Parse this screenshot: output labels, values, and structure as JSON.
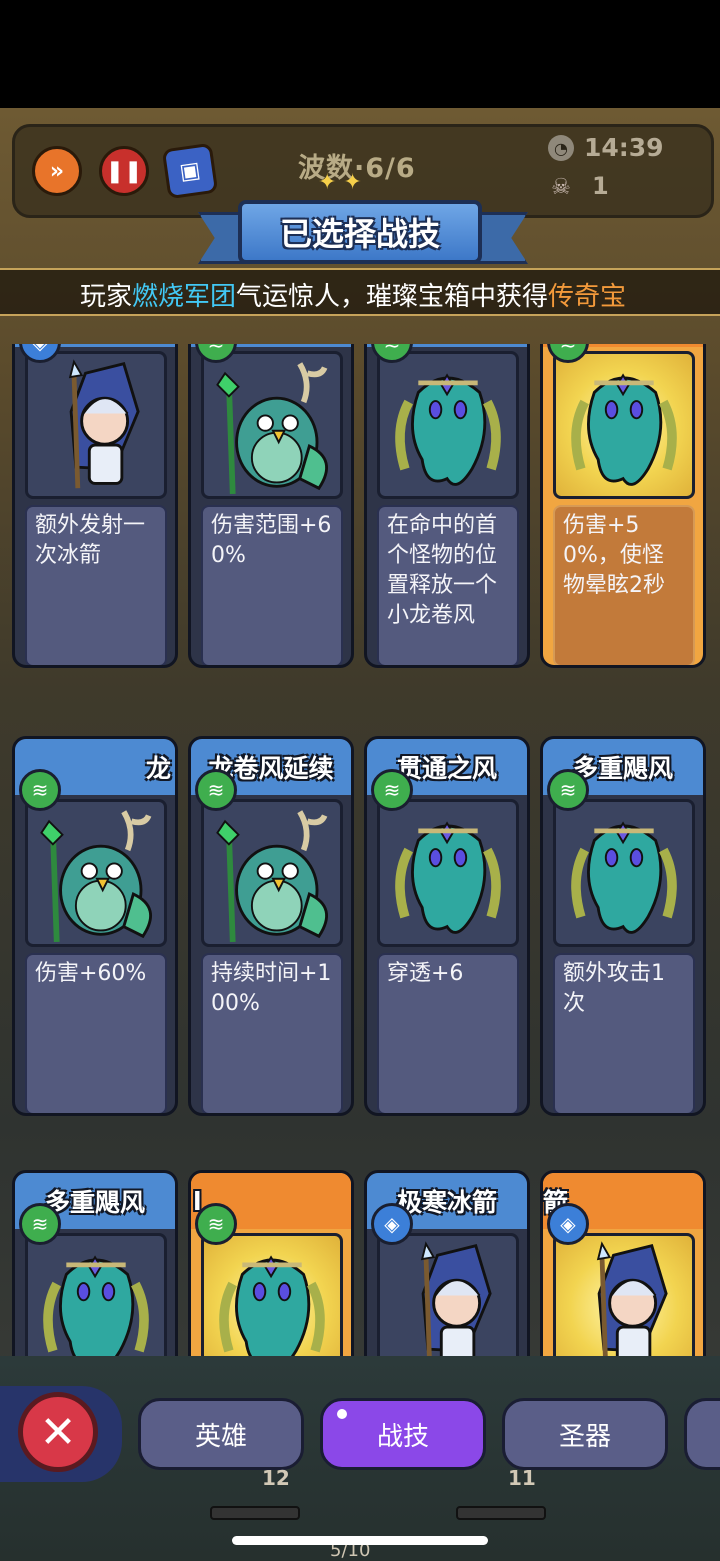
{
  "hud": {
    "wave_label": "波数·6/6",
    "timer": "14:39",
    "kills": "1",
    "speed_icon": "fast-forward-icon",
    "pause_icon": "pause-icon",
    "book_icon": "codex-icon"
  },
  "title": "已选择战技",
  "announcement": {
    "prefix": "玩家",
    "player": "燃烧军团",
    "middle": "气运惊人，璀璨宝箱中获得",
    "item": "传奇宝"
  },
  "cards": [
    {
      "name": "",
      "type": "ice",
      "hero": "mage",
      "legendary": false,
      "desc": "额外发射一次冰箭"
    },
    {
      "name": "",
      "type": "wind",
      "hero": "owl",
      "legendary": false,
      "desc": "伤害范围+60%"
    },
    {
      "name": "",
      "type": "wind",
      "hero": "spirit",
      "legendary": false,
      "desc": "在命中的首个怪物的位置释放一个小龙卷风"
    },
    {
      "name": "",
      "type": "wind",
      "hero": "spirit",
      "legendary": true,
      "desc": "伤害+50%，使怪物晕眩2秒"
    },
    {
      "name": "龙",
      "type": "wind",
      "hero": "owl",
      "legendary": false,
      "desc": "伤害+60%"
    },
    {
      "name": "龙卷风延续",
      "type": "wind",
      "hero": "owl",
      "legendary": false,
      "desc": "持续时间+100%"
    },
    {
      "name": "贯通之风",
      "type": "wind",
      "hero": "spirit",
      "legendary": false,
      "desc": "穿透+6"
    },
    {
      "name": "多重飓风",
      "type": "wind",
      "hero": "spirit",
      "legendary": false,
      "desc": "额外攻击1次"
    },
    {
      "name": "多重飓风",
      "type": "wind",
      "hero": "spirit",
      "legendary": false,
      "desc": ""
    },
    {
      "name": "l",
      "type": "wind",
      "hero": "spirit",
      "legendary": true,
      "desc": ""
    },
    {
      "name": "极寒冰箭",
      "type": "ice",
      "hero": "mage",
      "legendary": false,
      "desc": ""
    },
    {
      "name": "箭",
      "type": "ice",
      "hero": "mage",
      "legendary": true,
      "desc": ""
    }
  ],
  "tabs": {
    "heroes": "英雄",
    "skills": "战技",
    "relics": "圣器"
  },
  "bottom": {
    "level_left": "12",
    "level_right": "11",
    "progress": "5/10"
  },
  "colors": {
    "ribbon": "#4d8ad2",
    "legendary": "#f1a641",
    "active_tab": "#8b48e8",
    "close": "#d83848"
  }
}
